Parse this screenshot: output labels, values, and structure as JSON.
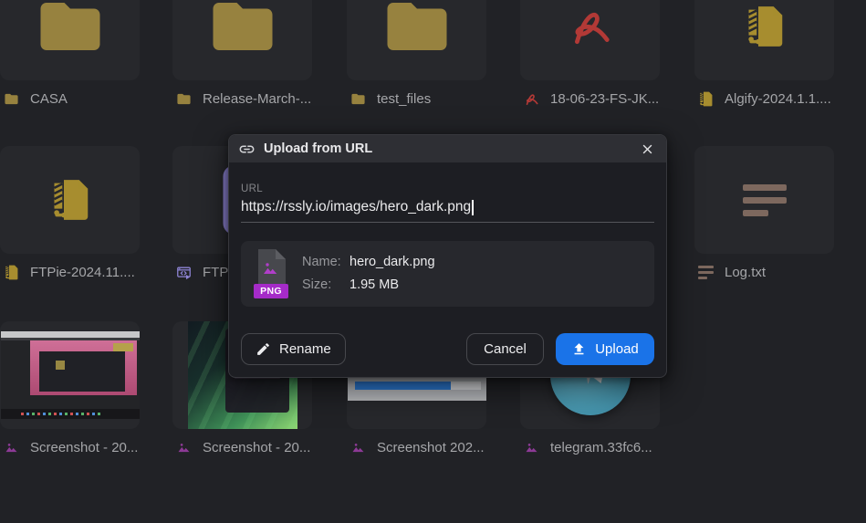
{
  "colors": {
    "page_bg": "#212226",
    "card_bg": "#27282c",
    "modal_header_bg": "#2e2f34",
    "modal_body_bg": "#1d1e23",
    "preview_bg": "#27282d",
    "accent_blue": "#1a73e8",
    "folder_gold": "#97823f",
    "archive_gold": "#a78d2f",
    "pdf_red": "#b23936",
    "app_purple": "#8f85d6",
    "text_brown": "#7d685e",
    "image_purple": "#8d3a96",
    "png_badge_purple": "#a52bc8",
    "telegram_teal": "#4b9cb4"
  },
  "icons": {
    "link-icon": "chain-link",
    "close-icon": "x-cross",
    "folder-icon": "folder",
    "pdf-icon": "acrobat-ribbon",
    "archive-icon": "zip-clamp-document",
    "app-icon": "app-window-code",
    "text-icon": "text-lines",
    "image-icon": "mountains-photo",
    "edit-icon": "pencil",
    "upload-icon": "arrow-up-tray"
  },
  "modal": {
    "title": "Upload from URL",
    "url_label": "URL",
    "url_value": "https://rssly.io/images/hero_dark.png",
    "file_preview": {
      "badge": "PNG",
      "name_label": "Name:",
      "name_value": "hero_dark.png",
      "size_label": "Size:",
      "size_value": "1.95 MB"
    },
    "actions": {
      "rename": "Rename",
      "cancel": "Cancel",
      "upload": "Upload"
    }
  },
  "files": [
    {
      "name": "CASA",
      "type": "folder"
    },
    {
      "name": "Release-March-...",
      "type": "folder"
    },
    {
      "name": "test_files",
      "type": "folder"
    },
    {
      "name": "18-06-23-FS-JK...",
      "type": "pdf"
    },
    {
      "name": "Algify-2024.1.1....",
      "type": "archive"
    },
    {
      "name": "FTPie-2024.11....",
      "type": "archive"
    },
    {
      "name": "FTP",
      "type": "app"
    },
    {
      "name": "Log.txt",
      "type": "text"
    },
    {
      "name": "Screenshot - 20...",
      "type": "image"
    },
    {
      "name": "Screenshot - 20...",
      "type": "image"
    },
    {
      "name": "Screenshot 202...",
      "type": "image"
    },
    {
      "name": "telegram.33fc6...",
      "type": "image"
    }
  ]
}
